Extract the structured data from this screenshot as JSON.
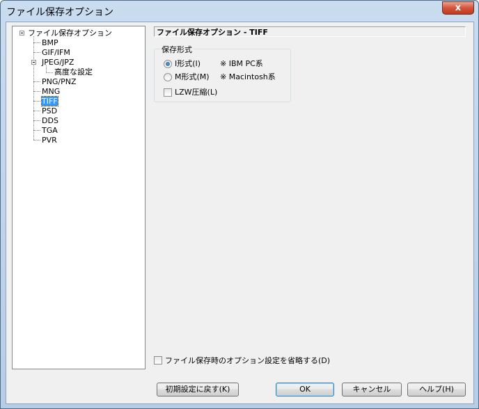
{
  "window": {
    "title": "ファイル保存オプション",
    "close_glyph": "x"
  },
  "tree": {
    "root": "ファイル保存オプション",
    "items": [
      "BMP",
      "GIF/IFM",
      "JPEG/JPZ",
      "高度な設定",
      "PNG/PNZ",
      "MNG",
      "TIFF",
      "PSD",
      "DDS",
      "TGA",
      "PVR"
    ],
    "selected": "TIFF"
  },
  "panel": {
    "header": "ファイル保存オプション - TIFF",
    "group_title": "保存形式",
    "radio_i": {
      "label": "I形式(I)",
      "note": "※ IBM PC系",
      "checked": true
    },
    "radio_m": {
      "label": "M形式(M)",
      "note": "※ Macintosh系",
      "checked": false
    },
    "lzw": {
      "label": "LZW圧縮(L)",
      "checked": false
    }
  },
  "bottom": {
    "skip_option": {
      "label": "ファイル保存時のオプション設定を省略する(D)",
      "checked": false
    },
    "reset_button": "初期設定に戻す(K)",
    "ok_button": "OK",
    "cancel_button": "キャンセル",
    "help_button": "ヘルプ(H)"
  }
}
